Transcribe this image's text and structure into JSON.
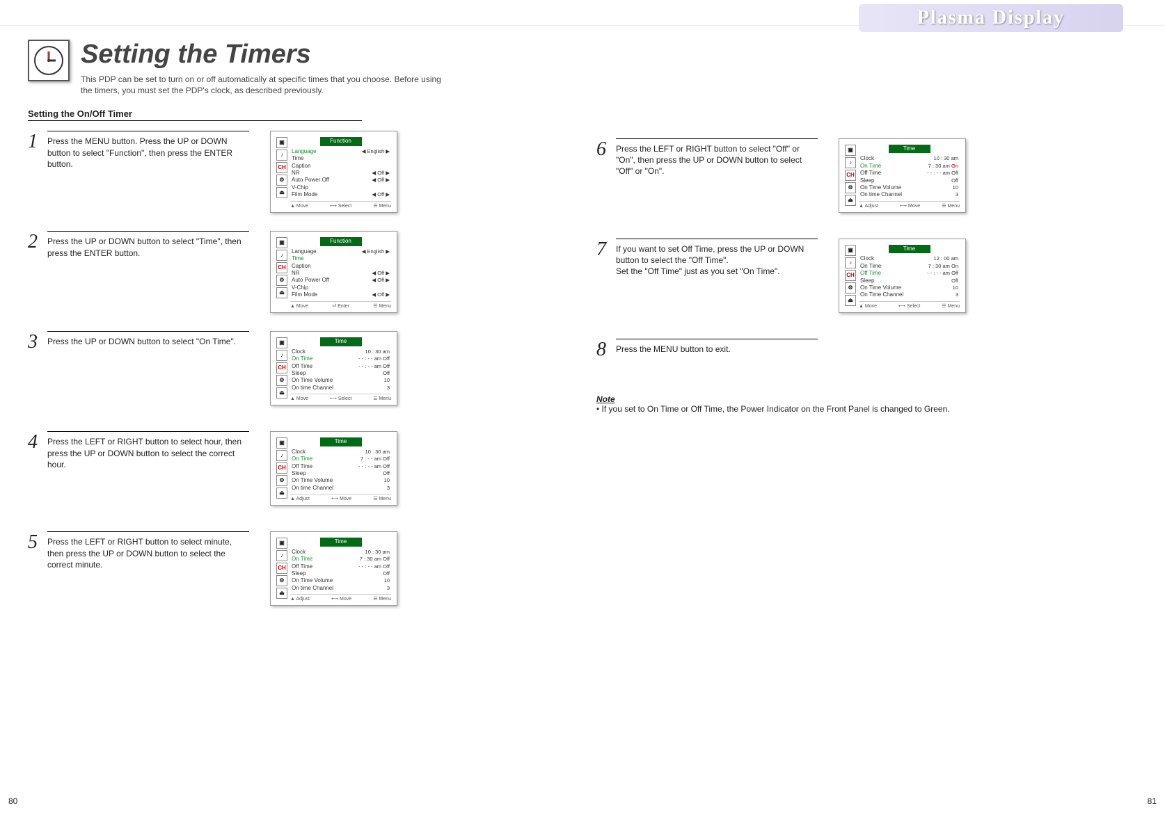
{
  "brand": "Plasma Display",
  "title": "Setting the Timers",
  "subtitle": "This PDP can be set to turn on or off automatically at specific times that you choose. Before using the timers, you must set the PDP's clock, as described previously.",
  "section_heading": "Setting the On/Off Timer",
  "page_left": "80",
  "page_right": "81",
  "steps": [
    {
      "num": "1",
      "text": "Press the MENU button. Press the UP or DOWN button to select \"Function\", then press the ENTER button."
    },
    {
      "num": "2",
      "text": "Press the UP or DOWN button to select \"Time\", then press the ENTER button."
    },
    {
      "num": "3",
      "text": "Press the UP or DOWN button to select \"On Time\"."
    },
    {
      "num": "4",
      "text": "Press the LEFT or RIGHT button to select hour, then press the UP or DOWN button to select the correct hour."
    },
    {
      "num": "5",
      "text": "Press the LEFT or RIGHT button to select minute, then press the UP or DOWN button to select the correct minute."
    },
    {
      "num": "6",
      "text": "Press the LEFT or RIGHT button to select \"Off\" or \"On\", then press the UP or DOWN button to select \"Off\" or \"On\"."
    },
    {
      "num": "7",
      "text": "If you want to set Off Time, press the UP or DOWN button to select the \"Off Time\".\nSet the \"Off Time\" just as you set \"On Time\"."
    },
    {
      "num": "8",
      "text": "Press the MENU button to exit."
    }
  ],
  "note_label": "Note",
  "note_text": "If you set to On Time or Off Time, the Power Indicator on the Front Panel is changed to Green.",
  "osd_function": {
    "title": "Function",
    "rows": [
      {
        "label": "Language",
        "val": "◀  English  ▶"
      },
      {
        "label": "Time",
        "val": ""
      },
      {
        "label": "Caption",
        "val": ""
      },
      {
        "label": "NR",
        "val": "◀  Off  ▶"
      },
      {
        "label": "Auto Power Off",
        "val": "◀  Off  ▶"
      },
      {
        "label": "V-Chip",
        "val": ""
      },
      {
        "label": "Film Mode",
        "val": "◀  Off  ▶"
      }
    ],
    "footer": [
      "▲ Move",
      "⟷ Select",
      "☰ Menu"
    ]
  },
  "osd_function2_footer": [
    "▲ Move",
    "⏎ Enter",
    "☰ Menu"
  ],
  "osd_time3": {
    "title": "Time",
    "rows": [
      [
        "Clock",
        "10 : 30  am",
        ""
      ],
      [
        "On Time",
        "- - : - -  am",
        "Off"
      ],
      [
        "Off Time",
        "- - : - -  am",
        "Off"
      ],
      [
        "Sleep",
        "",
        "Off"
      ],
      [
        "On Time Volume",
        "",
        "10"
      ],
      [
        "On time Channel",
        "",
        "3"
      ]
    ],
    "footer": [
      "▲ Move",
      "⟷ Select",
      "☰ Menu"
    ],
    "sel": "On Time"
  },
  "osd_time4": {
    "title": "Time",
    "rows": [
      [
        "Clock",
        "10 : 30  am",
        ""
      ],
      [
        "On Time",
        "7 : - -  am",
        "Off"
      ],
      [
        "Off Time",
        "- - : - -  am",
        "Off"
      ],
      [
        "Sleep",
        "",
        "Off"
      ],
      [
        "On Time Volume",
        "",
        "10"
      ],
      [
        "On time Channel",
        "",
        "3"
      ]
    ],
    "footer": [
      "▲ Adjust",
      "⟷ Move",
      "☰ Menu"
    ],
    "sel": "On Time"
  },
  "osd_time5": {
    "title": "Time",
    "rows": [
      [
        "Clock",
        "10 : 30  am",
        ""
      ],
      [
        "On Time",
        "7 : 30  am",
        "Off"
      ],
      [
        "Off Time",
        "- - : - -  am",
        "Off"
      ],
      [
        "Sleep",
        "",
        "Off"
      ],
      [
        "On Time Volume",
        "",
        "10"
      ],
      [
        "On time Channel",
        "",
        "3"
      ]
    ],
    "footer": [
      "▲ Adjust",
      "⟷ Move",
      "☰ Menu"
    ],
    "sel": "On Time"
  },
  "osd_time6": {
    "title": "Time",
    "rows": [
      [
        "Clock",
        "10 : 30  am",
        ""
      ],
      [
        "On Time",
        "7 : 30  am",
        "On"
      ],
      [
        "Off Time",
        "- - : - -  am",
        "Off"
      ],
      [
        "Sleep",
        "",
        "Off"
      ],
      [
        "On Time Volume",
        "",
        "10"
      ],
      [
        "On time Channel",
        "",
        "3"
      ]
    ],
    "footer": [
      "▲ Adjust",
      "⟷ Move",
      "☰ Menu"
    ],
    "sel": "On Time",
    "onred": true
  },
  "osd_time7": {
    "title": "Time",
    "rows": [
      [
        "Clock",
        "12 : 00  am",
        ""
      ],
      [
        "On Time",
        "7 : 30  am",
        "On"
      ],
      [
        "Off Time",
        "- - : - -  am",
        "Off"
      ],
      [
        "Sleep",
        "",
        "Off"
      ],
      [
        "On Time Volume",
        "",
        "10"
      ],
      [
        "On Time Channel",
        "",
        "3"
      ]
    ],
    "footer": [
      "▲ Move",
      "⟷ Select",
      "☰ Menu"
    ],
    "sel": "Off Time"
  },
  "icons": {
    "ch": "CH",
    "pic": "▣",
    "snd": "♪",
    "set": "⚙",
    "ex": "⏏"
  }
}
